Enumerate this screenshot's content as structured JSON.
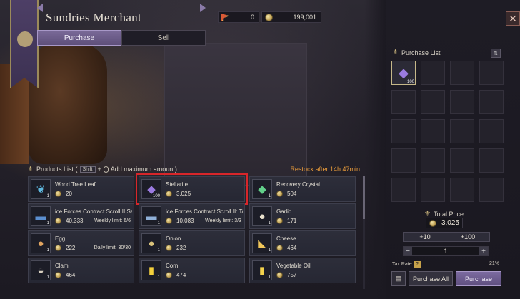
{
  "window": {
    "title": "Sundries Merchant",
    "close_glyph": "✕"
  },
  "currency": [
    {
      "icon": "flag-icon",
      "value": "0"
    },
    {
      "icon": "coin-icon",
      "value": "199,001"
    }
  ],
  "tabs": [
    {
      "label": "Purchase",
      "active": true
    },
    {
      "label": "Sell",
      "active": false
    }
  ],
  "products_header": {
    "label": "Products List (",
    "key": "Shift",
    "plus": "+",
    "hint": "Add maximum amount)",
    "restock": "Restock after  14h 47min"
  },
  "products": [
    {
      "name": "World Tree Leaf",
      "price": "20",
      "qty": "1",
      "limit": "",
      "icon": "leaf-icon",
      "glyph": "❦",
      "color": "#5fb9e0"
    },
    {
      "name": "Stellarite",
      "price": "3,025",
      "qty": "100",
      "limit": "",
      "icon": "crystal-icon",
      "glyph": "◆",
      "color": "#9b7be0",
      "selected": true
    },
    {
      "name": "Recovery Crystal",
      "price": "504",
      "qty": "1",
      "limit": "",
      "icon": "green-crystal-icon",
      "glyph": "◆",
      "color": "#62d08a"
    },
    {
      "name": "ice Forces Contract Scroll II Selection C",
      "price": "40,333",
      "qty": "1",
      "limit": "Weekly limit: 6/6",
      "icon": "scroll-icon",
      "glyph": "▬",
      "color": "#5b8fd0"
    },
    {
      "name": "ice Forces Contract Scroll II: Taedal's T",
      "price": "10,083",
      "qty": "1",
      "limit": "Weekly limit: 3/3",
      "icon": "scroll-icon",
      "glyph": "▬",
      "color": "#8fb0d8"
    },
    {
      "name": "Garlic",
      "price": "171",
      "qty": "1",
      "limit": "",
      "icon": "garlic-icon",
      "glyph": "●",
      "color": "#e8e0cc"
    },
    {
      "name": "Egg",
      "price": "222",
      "qty": "1",
      "limit": "Daily limit: 30/30",
      "icon": "egg-icon",
      "glyph": "●",
      "color": "#e0a460"
    },
    {
      "name": "Onion",
      "price": "232",
      "qty": "1",
      "limit": "",
      "icon": "onion-icon",
      "glyph": "●",
      "color": "#d9c27a"
    },
    {
      "name": "Cheese",
      "price": "464",
      "qty": "1",
      "limit": "",
      "icon": "cheese-icon",
      "glyph": "◣",
      "color": "#f0c65a"
    },
    {
      "name": "Clam",
      "price": "464",
      "qty": "1",
      "limit": "",
      "icon": "clam-icon",
      "glyph": "◒",
      "color": "#d8d0c0"
    },
    {
      "name": "Corn",
      "price": "474",
      "qty": "1",
      "limit": "",
      "icon": "corn-icon",
      "glyph": "▮",
      "color": "#f2cf3c"
    },
    {
      "name": "Vegetable Oil",
      "price": "757",
      "qty": "1",
      "limit": "",
      "icon": "oil-bottle-icon",
      "glyph": "▮",
      "color": "#f2d24c"
    }
  ],
  "purchase_list": {
    "title": "Purchase List",
    "slots": [
      {
        "filled": true,
        "qty": "100",
        "glyph": "◆",
        "color": "#9b7be0"
      },
      {
        "filled": false
      },
      {
        "filled": false
      },
      {
        "filled": false
      },
      {
        "filled": false
      },
      {
        "filled": false
      },
      {
        "filled": false
      },
      {
        "filled": false
      },
      {
        "filled": false
      },
      {
        "filled": false
      },
      {
        "filled": false
      },
      {
        "filled": false
      },
      {
        "filled": false
      },
      {
        "filled": false
      },
      {
        "filled": false
      },
      {
        "filled": false
      },
      {
        "filled": false
      },
      {
        "filled": false
      },
      {
        "filled": false
      },
      {
        "filled": false
      }
    ]
  },
  "total": {
    "label": "Total Price",
    "value": "3,025"
  },
  "quantity": {
    "plus10": "+10",
    "plus100": "+100",
    "minus": "−",
    "plus": "+",
    "value": "1"
  },
  "tax": {
    "label": "Tax Rate",
    "help": "?",
    "value": "21%"
  },
  "buttons": {
    "purchase_all": "Purchase All",
    "purchase": "Purchase"
  }
}
